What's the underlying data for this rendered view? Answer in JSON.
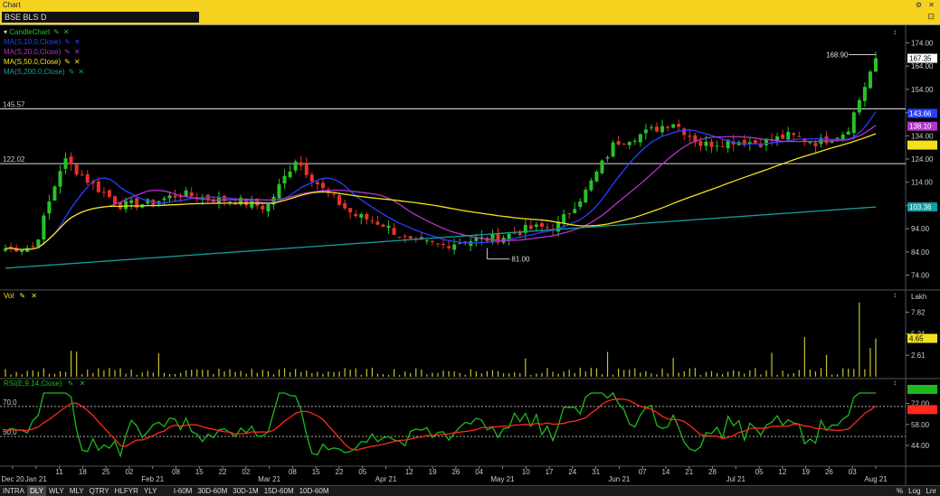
{
  "window": {
    "title": "Chart",
    "symbol": "BSE BLS D"
  },
  "colors": {
    "up": "#27c327",
    "down": "#e8322a",
    "ma10": "#2a3fff",
    "ma20": "#b235c8",
    "ma50": "#f3e21b",
    "ma200": "#159ea0",
    "rsi": "#1fb81f",
    "rsi_signal": "#ff2a1a",
    "vol": "#c9c12a"
  },
  "price_panel": {
    "legend": [
      {
        "label": "CandleChart",
        "color": "#27c327"
      },
      {
        "label": "MA(S,10.0,Close)",
        "color": "#2a3fff"
      },
      {
        "label": "MA(S,20.0,Close)",
        "color": "#b235c8"
      },
      {
        "label": "MA(S,50.0,Close)",
        "color": "#f3e21b"
      },
      {
        "label": "MA(S,200.0,Close)",
        "color": "#159ea0"
      }
    ],
    "hline_labels": [
      "145.57",
      "122.02"
    ],
    "ticks": [
      "174.00",
      "164.00",
      "154.00",
      "144.00",
      "134.00",
      "124.00",
      "114.00",
      "104.00",
      "94.00",
      "84.00",
      "74.00"
    ],
    "badges": [
      "167.35",
      "143.66",
      "138.10",
      "103.36"
    ],
    "annotations": [
      "168.90",
      "81.00"
    ]
  },
  "volume_panel": {
    "label": "Vol",
    "unit": "Lakh",
    "ticks": [
      "7.82",
      "5.21",
      "2.61"
    ],
    "badge": "4.65"
  },
  "rsi_panel": {
    "label": "RSI(E,9,14,Close)",
    "ticks": [
      "72.00",
      "58.00",
      "44.00"
    ],
    "levels": [
      "70.0",
      "50.0"
    ]
  },
  "x_axis": {
    "labels": [
      "Dec 20",
      "Jan 21",
      "11",
      "18",
      "25",
      "02",
      "Feb 21",
      "08",
      "15",
      "22",
      "02",
      "Mar 21",
      "08",
      "15",
      "22",
      "05",
      "Apr 21",
      "12",
      "19",
      "26",
      "04",
      "May 21",
      "10",
      "17",
      "24",
      "31",
      "Jun 21",
      "07",
      "14",
      "21",
      "28",
      "Jul 21",
      "05",
      "12",
      "19",
      "26",
      "03",
      "Aug 21"
    ]
  },
  "statusbar": {
    "periods": [
      "INTRA",
      "DLY",
      "WLY",
      "MLY",
      "QTRY",
      "HLFYR",
      "YLY"
    ],
    "active_period": "DLY",
    "intervals": [
      "I-60M",
      "30D-60M",
      "30D-1M",
      "15D-60M",
      "10D-60M"
    ],
    "right": [
      "%",
      "Log",
      "Lnr"
    ]
  },
  "chart_data": {
    "type": "candlestick",
    "anchors": [
      [
        "Dec 20",
        85.5
      ],
      [
        "Jan 21",
        86
      ],
      [
        "11",
        124
      ],
      [
        "18",
        113
      ],
      [
        "25",
        104
      ],
      [
        "02",
        105
      ],
      [
        "08",
        109
      ],
      [
        "15",
        107
      ],
      [
        "22",
        106
      ],
      [
        "02",
        103
      ],
      [
        "08",
        124
      ],
      [
        "15",
        110
      ],
      [
        "22",
        100
      ],
      [
        "05",
        96
      ],
      [
        "12",
        88
      ],
      [
        "19",
        87
      ],
      [
        "26",
        89
      ],
      [
        "04",
        90
      ],
      [
        "10",
        94
      ],
      [
        "17",
        95
      ],
      [
        "24",
        110
      ],
      [
        "31",
        131
      ],
      [
        "07",
        135
      ],
      [
        "14",
        140
      ],
      [
        "21",
        130
      ],
      [
        "28",
        132
      ],
      [
        "05",
        131
      ],
      [
        "12",
        134
      ],
      [
        "19",
        131
      ],
      [
        "26",
        136
      ],
      [
        "03",
        167.35
      ]
    ],
    "ma_end": {
      "ma10": 143.66,
      "ma20": 138.1,
      "ma50": 130,
      "ma200": 103.36
    },
    "y_range": [
      68,
      180
    ],
    "high_annotation": 168.9,
    "low_annotation": 81.0,
    "volume_range": [
      0,
      9.2
    ],
    "rsi_range": [
      35,
      82
    ]
  }
}
